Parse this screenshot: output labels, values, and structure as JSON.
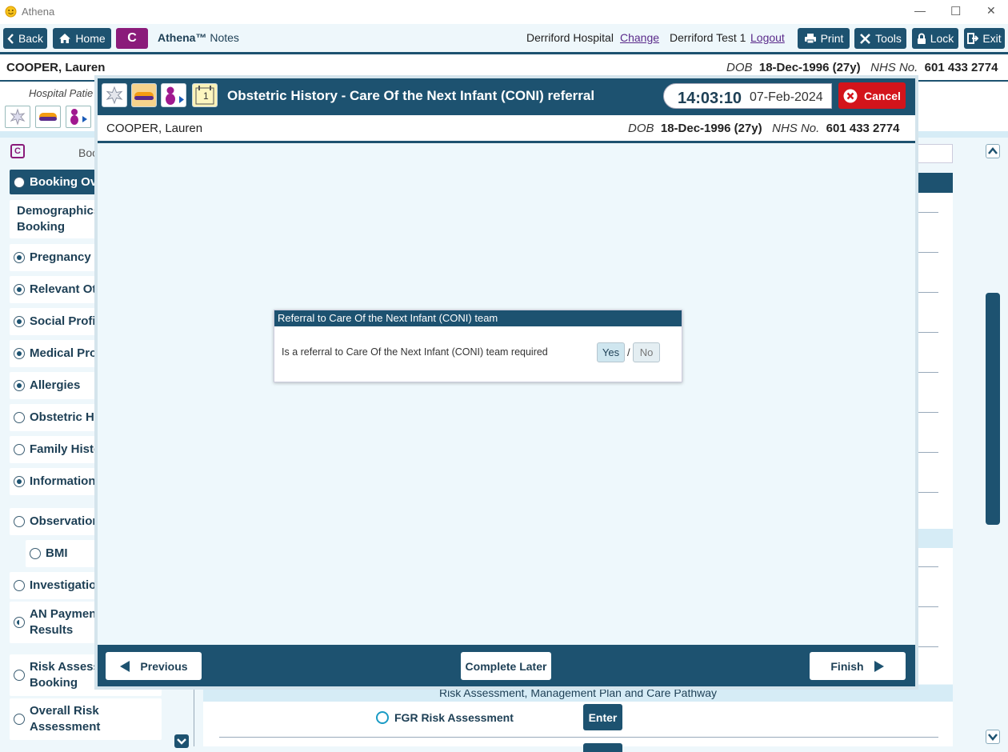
{
  "window": {
    "title": "Athena",
    "minimize_glyph": "—",
    "maximize_glyph": "☐",
    "close_glyph": "✕"
  },
  "toolbar": {
    "back": "Back",
    "home": "Home",
    "c_badge": "C",
    "app_name": "Athena™",
    "app_section": "Notes",
    "hospital": "Derriford Hospital",
    "change": "Change",
    "user": "Derriford Test 1",
    "logout": "Logout",
    "print": "Print",
    "tools": "Tools",
    "lock": "Lock",
    "exit": "Exit"
  },
  "patient": {
    "name": "COOPER, Lauren",
    "dob_label": "DOB",
    "dob": "18-Dec-1996 (27y)",
    "nhs_label": "NHS No.",
    "nhs": "601 433 2774"
  },
  "background": {
    "hospital_patient_partial": "Hospital Patie",
    "booking_partial": "Boo",
    "sidebar": [
      {
        "label": "Booking Ove",
        "radio": "empty",
        "active": true
      },
      {
        "label": "Demographics\nBooking",
        "radio": "none"
      },
      {
        "label": "Pregnancy P",
        "radio": "fill"
      },
      {
        "label": "Relevant Oth",
        "radio": "fill"
      },
      {
        "label": "Social Profil",
        "radio": "fill"
      },
      {
        "label": "Medical Pro",
        "radio": "fill"
      },
      {
        "label": "Allergies",
        "radio": "fill"
      },
      {
        "label": "Obstetric Hi",
        "radio": "empty"
      },
      {
        "label": "Family Histo",
        "radio": "empty"
      },
      {
        "label": "Information",
        "radio": "fill"
      },
      {
        "label": "Observation",
        "radio": "empty"
      },
      {
        "label": "BMI",
        "radio": "empty",
        "indent": true
      },
      {
        "label": "Investigatio",
        "radio": "empty"
      },
      {
        "label": "AN Paymen\nResults",
        "radio": "half"
      },
      {
        "label": "Risk Assess\nBooking",
        "radio": "empty"
      },
      {
        "label": "Overall Risk\nAssessment",
        "radio": "empty"
      }
    ],
    "risk_section_title": "Risk Assessment, Management Plan and Care Pathway",
    "fgr_label": "FGR Risk Assessment",
    "enter_label": "Enter"
  },
  "modal": {
    "title": "Obstetric History - Care Of the Next Infant (CONI) referral",
    "time": "14:03:10",
    "date": "07-Feb-2024",
    "cancel": "Cancel",
    "calendar_number": "1",
    "question_box": {
      "header": "Referral to Care Of the Next Infant (CONI) team",
      "question": "Is a referral to Care Of the Next Infant (CONI) team required",
      "yes": "Yes",
      "separator": "/",
      "no": "No"
    },
    "previous": "Previous",
    "complete_later": "Complete Later",
    "finish": "Finish"
  },
  "colors": {
    "primary": "#1d5270",
    "accent_purple": "#8a1b7a",
    "cancel_red": "#d3141b",
    "panel_bg": "#eef8fc"
  }
}
